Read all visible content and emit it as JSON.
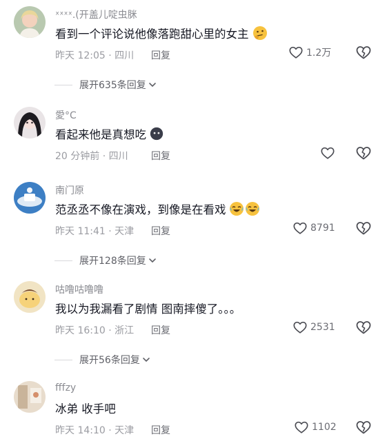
{
  "comments": [
    {
      "username": "ˣˣˣˣ.(开盖儿啶虫脒",
      "text": "看到一个评论说他像落跑甜心里的女主",
      "emoji": "thinking-emoji",
      "time_location": "昨天 12:05 · 四川",
      "reply_label": "回复",
      "likes": "1.2万",
      "expand_label": "展开635条回复"
    },
    {
      "username": "愛°C",
      "text": "看起来他是真想吃",
      "emoji": "dark-face-emoji",
      "time_location": "20 分钟前 · 四川",
      "reply_label": "回复",
      "likes": ""
    },
    {
      "username": "南门原",
      "text": "范丞丞不像在演戏，到像是在看戏",
      "emoji": "laughing-crying-emoji",
      "time_location": "昨天 11:41 · 天津",
      "reply_label": "回复",
      "likes": "8791",
      "expand_label": "展开128条回复"
    },
    {
      "username": "咕噜咕噜噜",
      "text": "我以为我漏看了剧情 图南摔傻了。。。",
      "emoji": "",
      "time_location": "昨天 16:10 · 浙江",
      "reply_label": "回复",
      "likes": "2531",
      "expand_label": "展开56条回复"
    },
    {
      "username": "fffzy",
      "text": "冰弟 收手吧",
      "emoji": "",
      "time_location": "昨天 14:10 · 天津",
      "reply_label": "回复",
      "likes": "1102"
    }
  ],
  "colors": {
    "primary_text": "#161823",
    "secondary_text": "#8a8b91",
    "icon": "#4a4b52"
  },
  "icons": {
    "like": "heart-outline-icon",
    "dislike": "broken-heart-icon",
    "expand": "chevron-down-icon"
  }
}
